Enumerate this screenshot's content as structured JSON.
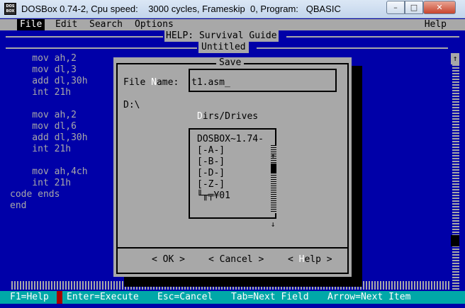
{
  "window": {
    "icon_text_top": "DOS",
    "icon_text_bottom": "BOX",
    "title": "DOSBox 0.74-2, Cpu speed:    3000 cycles, Frameskip  0, Program:   QBASIC",
    "minimize_glyph": "–",
    "maximize_glyph": "□",
    "close_glyph": "✕"
  },
  "menu": {
    "file": "File",
    "edit": "Edit",
    "search": "Search",
    "options": "Options",
    "help": "Help"
  },
  "help_title": "HELP: Survival Guide",
  "editor": {
    "title": "Untitled",
    "lines": [
      "    mov ah,2",
      "    mov dl,3",
      "    add dl,30h",
      "    int 21h",
      "",
      "    mov ah,2",
      "    mov dl,6",
      "    add dl,30h",
      "    int 21h",
      "",
      "    mov ah,4ch",
      "    int 21h",
      "code ends",
      "end"
    ],
    "scroll_up_glyph": "↑"
  },
  "dialog": {
    "title": "Save",
    "file_name_label_pre": "File ",
    "file_name_label_hot": "N",
    "file_name_label_post": "ame:",
    "file_name_value": "t1.asm_",
    "current_dir": "D:\\",
    "dirs_label_hot": "D",
    "dirs_label_rest": "irs/Drives",
    "dirs": [
      "DOSBOX~1.74-",
      "[-A-]",
      "[-B-]",
      "[-D-]",
      "[-Z-]",
      "╙╥╤¥01"
    ],
    "scroll_up_glyph": "↑",
    "scroll_down_glyph": "↓",
    "ok_label": "< OK >",
    "cancel_label": "< Cancel >",
    "help_pre": "< ",
    "help_hot": "H",
    "help_post": "elp >"
  },
  "status": {
    "f1": "F1=Help",
    "enter": "Enter=Execute",
    "esc": "Esc=Cancel",
    "tab": "Tab=Next Field",
    "arrow": "Arrow=Next Item"
  },
  "colors": {
    "dos_blue": "#0000a8",
    "dos_gray": "#a8a8a8",
    "status_cyan": "#00a8a8",
    "white": "#ffffff"
  }
}
